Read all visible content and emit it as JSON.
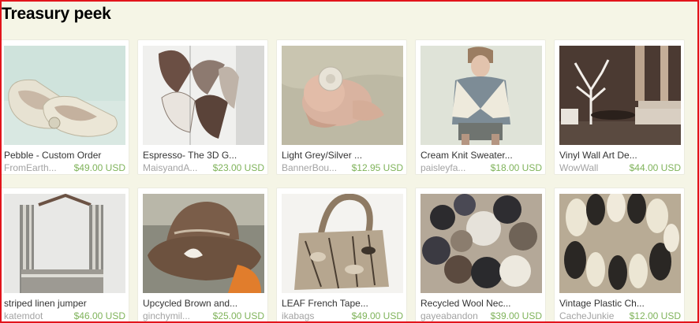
{
  "section": {
    "title": "Treasury peek"
  },
  "items": [
    {
      "title": "Pebble - Custom Order",
      "shop": "FromEarth...",
      "price": "$49.00 USD",
      "image": "fabric-slippers"
    },
    {
      "title": "Espresso- The 3D G...",
      "shop": "MaisyandA...",
      "price": "$23.00 USD",
      "image": "3d-paper-garland"
    },
    {
      "title": "Light Grey/Silver ...",
      "shop": "BannerBou...",
      "price": "$12.95 USD",
      "image": "baby-flower-headband"
    },
    {
      "title": "Cream Knit Sweater...",
      "shop": "paisleyfa...",
      "price": "$18.00 USD",
      "image": "cream-knit-sweater"
    },
    {
      "title": "Vinyl Wall Art De...",
      "shop": "WowWall",
      "price": "$44.00 USD",
      "image": "tree-wall-decal-room"
    },
    {
      "title": "striped linen jumper",
      "shop": "katemdot",
      "price": "$46.00 USD",
      "image": "striped-jumper-hanger"
    },
    {
      "title": "Upcycled Brown and...",
      "shop": "ginchymil...",
      "price": "$25.00 USD",
      "image": "brown-fabric-hat"
    },
    {
      "title": "LEAF French Tape...",
      "shop": "ikabags",
      "price": "$49.00 USD",
      "image": "leaf-print-bag"
    },
    {
      "title": "Recycled Wool Nec...",
      "shop": "gayeabandon",
      "price": "$39.00 USD",
      "image": "wool-circle-necklace"
    },
    {
      "title": "Vintage Plastic Ch...",
      "shop": "CacheJunkie",
      "price": "$12.00 USD",
      "image": "plastic-bead-bracelet"
    }
  ],
  "colors": {
    "border": "#e2141b",
    "background": "#f5f5e6",
    "price": "#7fb35a",
    "shop": "#a3a3a3"
  }
}
